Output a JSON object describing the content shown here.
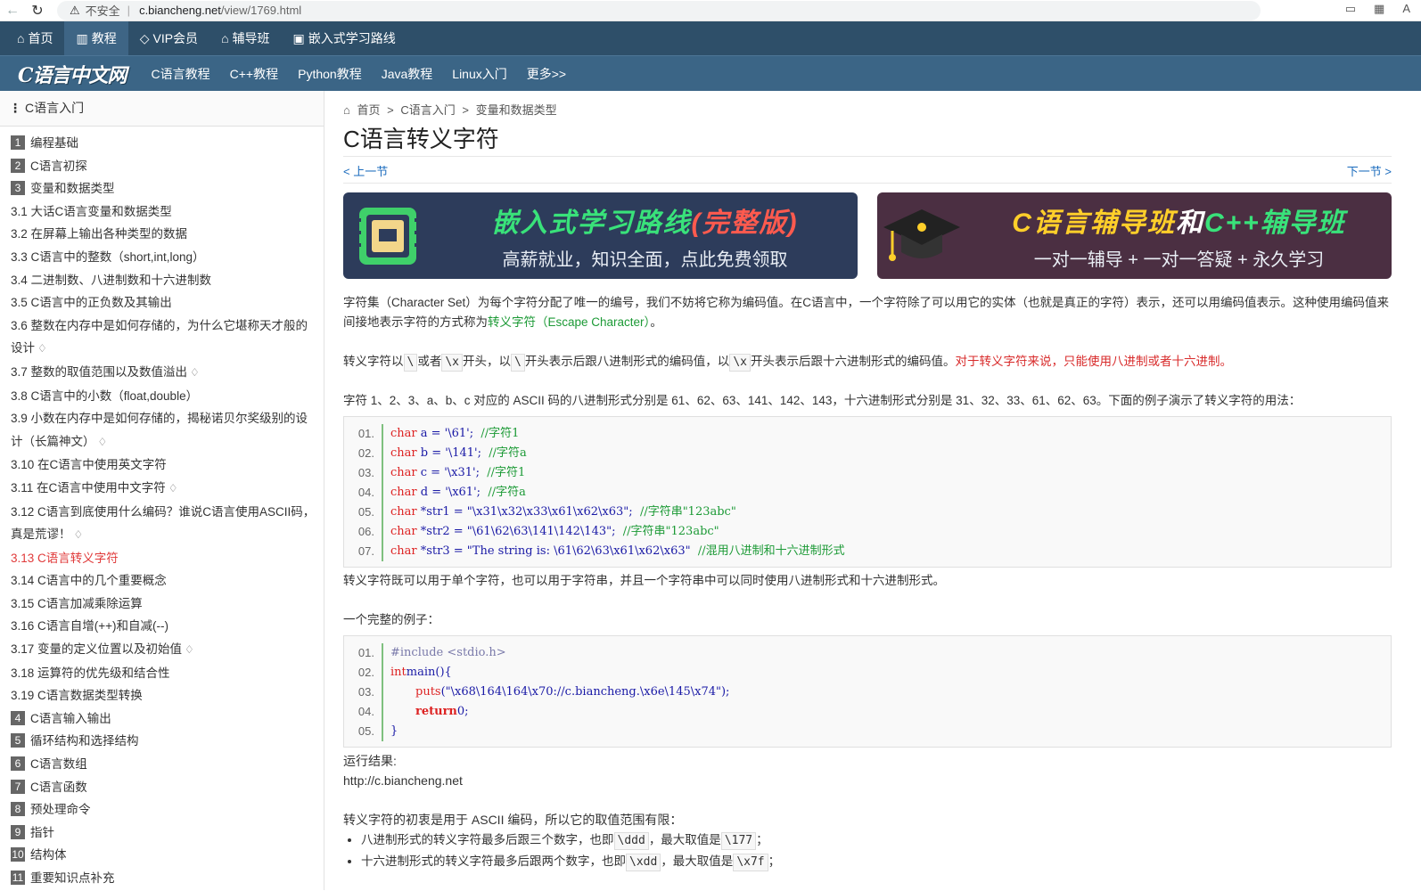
{
  "browser": {
    "insecure_label": "不安全",
    "url_host": "c.biancheng.net",
    "url_path": "/view/1769.html"
  },
  "topnav": [
    {
      "icon": "home-icon",
      "glyph": "⌂",
      "label": "首页"
    },
    {
      "icon": "book-icon",
      "glyph": "▥",
      "label": "教程"
    },
    {
      "icon": "diamond-icon",
      "glyph": "◇",
      "label": "VIP会员"
    },
    {
      "icon": "graduation-icon",
      "glyph": "⌂",
      "label": "辅导班"
    },
    {
      "icon": "route-icon",
      "glyph": "▣",
      "label": "嵌入式学习路线"
    }
  ],
  "subnav": {
    "logo": "C语言中文网",
    "items": [
      "C语言教程",
      "C++教程",
      "Python教程",
      "Java教程",
      "Linux入门",
      "更多>>"
    ]
  },
  "sidebar": {
    "title": "C语言入门",
    "items": [
      {
        "num": "1",
        "label": "编程基础"
      },
      {
        "num": "2",
        "label": "C语言初探"
      },
      {
        "num": "3",
        "label": "变量和数据类型"
      },
      {
        "label": "3.1 大话C语言变量和数据类型"
      },
      {
        "label": "3.2 在屏幕上输出各种类型的数据"
      },
      {
        "label": "3.3 C语言中的整数（short,int,long）"
      },
      {
        "label": "3.4 二进制数、八进制数和十六进制数"
      },
      {
        "label": "3.5 C语言中的正负数及其输出"
      },
      {
        "label": "3.6 整数在内存中是如何存储的，为什么它堪称天才般的设计",
        "vip": true
      },
      {
        "label": "3.7 整数的取值范围以及数值溢出",
        "vip": true
      },
      {
        "label": "3.8 C语言中的小数（float,double）"
      },
      {
        "label": "3.9 小数在内存中是如何存储的，揭秘诺贝尔奖级别的设计（长篇神文）",
        "vip": true
      },
      {
        "label": "3.10 在C语言中使用英文字符"
      },
      {
        "label": "3.11 在C语言中使用中文字符",
        "vip": true
      },
      {
        "label": "3.12 C语言到底使用什么编码？谁说C语言使用ASCII码，真是荒谬！",
        "vip": true
      },
      {
        "label": "3.13 C语言转义字符",
        "active": true
      },
      {
        "label": "3.14 C语言中的几个重要概念"
      },
      {
        "label": "3.15 C语言加减乘除运算"
      },
      {
        "label": "3.16 C语言自增(++)和自减(--)"
      },
      {
        "label": "3.17 变量的定义位置以及初始值",
        "vip": true
      },
      {
        "label": "3.18 运算符的优先级和结合性"
      },
      {
        "label": "3.19 C语言数据类型转换"
      },
      {
        "num": "4",
        "label": "C语言输入输出"
      },
      {
        "num": "5",
        "label": "循环结构和选择结构"
      },
      {
        "num": "6",
        "label": "C语言数组"
      },
      {
        "num": "7",
        "label": "C语言函数"
      },
      {
        "num": "8",
        "label": "预处理命令"
      },
      {
        "num": "9",
        "label": "指针"
      },
      {
        "num": "10",
        "label": "结构体"
      },
      {
        "num": "11",
        "label": "重要知识点补充"
      }
    ]
  },
  "main": {
    "breadcrumb": [
      "首页",
      ">",
      "C语言入门",
      ">",
      "变量和数据类型"
    ],
    "title": "C语言转义字符",
    "prev": "< 上一节",
    "next": "下一节 >",
    "banner1": {
      "title_a": "嵌入式学习路线",
      "title_b": "(完整版)",
      "sub": "高薪就业，知识全面，点此免费领取"
    },
    "banner2": {
      "title_a": "C语言辅导班",
      "title_b": "和",
      "title_c": "C++辅导班",
      "sub": "一对一辅导 + 一对一答疑 + 永久学习"
    },
    "p1a": "字符集（Character Set）为每个字符分配了唯一的编号，我们不妨将它称为编码值。在C语言中，一个字符除了可以用它的实体（也就是真正的字符）表示，还可以用编码值表示。这种使用编码值来间接地表示字符的方式称为",
    "p1link": "转义字符（Escape Character）",
    "p1b": "。",
    "p2": {
      "t1": "转义字符以",
      "k1": "\\",
      "t2": "或者",
      "k2": "\\x",
      "t3": "开头，以",
      "k3": "\\",
      "t4": "开头表示后跟八进制形式的编码值，以",
      "k4": "\\x",
      "t5": "开头表示后跟十六进制形式的编码值。",
      "red": "对于转义字符来说，只能使用八进制或者十六进制。"
    },
    "p3": "字符 1、2、3、a、b、c 对应的 ASCII 码的八进制形式分别是 61、62、63、141、142、143，十六进制形式分别是 31、32、33、61、62、63。下面的例子演示了转义字符的用法：",
    "code1": [
      {
        "ln": "01.",
        "kw": "char",
        "body": " a = ",
        "str": "'\\61'",
        "end": ";  ",
        "cm": "//字符1"
      },
      {
        "ln": "02.",
        "kw": "char",
        "body": " b = ",
        "str": "'\\141'",
        "end": ";  ",
        "cm": "//字符a"
      },
      {
        "ln": "03.",
        "kw": "char",
        "body": " c = ",
        "str": "'\\x31'",
        "end": ";  ",
        "cm": "//字符1"
      },
      {
        "ln": "04.",
        "kw": "char",
        "body": " d = ",
        "str": "'\\x61'",
        "end": ";  ",
        "cm": "//字符a"
      },
      {
        "ln": "05.",
        "kw": "char",
        "body": " *str1 = ",
        "str": "\"\\x31\\x32\\x33\\x61\\x62\\x63\"",
        "end": ";  ",
        "cm": "//字符串\"123abc\""
      },
      {
        "ln": "06.",
        "kw": "char",
        "body": " *str2 = ",
        "str": "\"\\61\\62\\63\\141\\142\\143\"",
        "end": ";  ",
        "cm": "//字符串\"123abc\""
      },
      {
        "ln": "07.",
        "kw": "char",
        "body": " *str3 = ",
        "str": "\"The string is: \\61\\62\\63\\x61\\x62\\x63\"",
        "end": "  ",
        "cm": "//混用八进制和十六进制形式"
      }
    ],
    "p4": "转义字符既可以用于单个字符，也可以用于字符串，并且一个字符串中可以同时使用八进制形式和十六进制形式。",
    "p5": "一个完整的例子：",
    "code2": {
      "l1": {
        "ln": "01.",
        "text": "#include <stdio.h>"
      },
      "l2": {
        "ln": "02.",
        "kw": "int",
        "text": " main(){"
      },
      "l3": {
        "ln": "03.",
        "fn": "puts",
        "str": "(\"\\x68\\164\\164\\x70://c.biancheng.\\x6e\\145\\x74\");"
      },
      "l4": {
        "ln": "04.",
        "kw": "return",
        "text": " 0;"
      },
      "l5": {
        "ln": "05.",
        "text": "}"
      }
    },
    "result_label": "运行结果:",
    "result": "http://c.biancheng.net",
    "p6": "转义字符的初衷是用于 ASCII 编码，所以它的取值范围有限：",
    "li1": {
      "t1": "八进制形式的转义字符最多后跟三个数字，也即",
      "k1": "\\ddd",
      "t2": "，最大取值是",
      "k2": "\\177",
      "t3": "；"
    },
    "li2": {
      "t1": "十六进制形式的转义字符最多后跟两个数字，也即",
      "k1": "\\xdd",
      "t2": "，最大取值是",
      "k2": "\\x7f",
      "t3": "；"
    }
  }
}
